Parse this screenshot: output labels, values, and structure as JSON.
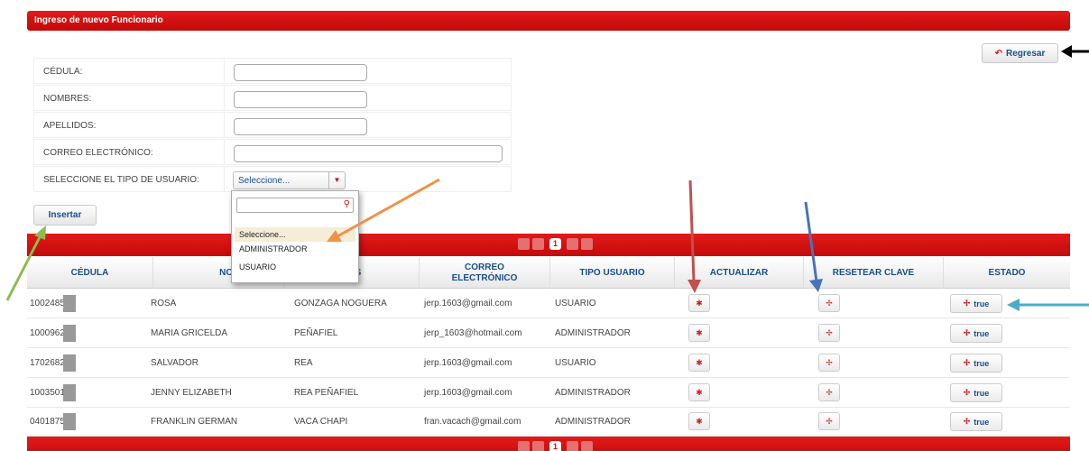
{
  "header": {
    "title": "Ingreso de nuevo Funcionario"
  },
  "back_button": {
    "label": "Regresar",
    "icon": "undo-icon"
  },
  "form": {
    "cedula_label": "CÉDULA:",
    "nombres_label": "NOMBRES:",
    "apellidos_label": "APELLIDOS:",
    "correo_label": "CORREO ELECTRÓNICO:",
    "tipo_label": "SELECCIONE EL TIPO DE USUARIO:",
    "tipo_selected": "Seleccione..."
  },
  "dropdown": {
    "options": [
      "Seleccione...",
      "ADMINISTRADOR",
      "USUARIO"
    ]
  },
  "insert_button": {
    "label": "Insertar"
  },
  "pager": {
    "current_page": "1"
  },
  "table": {
    "headers": [
      "CÉDULA",
      "NOMBRES",
      "APELLIDOS",
      "CORREO ELECTRÓNICO",
      "TIPO USUARIO",
      "ACTUALIZAR",
      "RESETEAR CLAVE",
      "ESTADO"
    ],
    "header_nombres_visible": "NOMBR",
    "header_apellidos_visible": "DOS",
    "rows": [
      {
        "cedula": "1002485",
        "nombres": "ROSA",
        "apellidos": "GONZAGA NOGUERA",
        "correo": "jerp.1603@gmail.com",
        "tipo": "USUARIO",
        "estado": "true"
      },
      {
        "cedula": "1000962",
        "nombres": "MARIA GRICELDA",
        "apellidos": "PEÑAFIEL",
        "correo": "jerp_1603@hotmail.com",
        "tipo": "ADMINISTRADOR",
        "estado": "true"
      },
      {
        "cedula": "1702682",
        "nombres": "SALVADOR",
        "apellidos": "REA",
        "correo": "jerp.1603@gmail.com",
        "tipo": "USUARIO",
        "estado": "true"
      },
      {
        "cedula": "1003501",
        "nombres": "JENNY ELIZABETH",
        "apellidos": "REA PEÑAFIEL",
        "correo": "jerp.1603@gmail.com",
        "tipo": "ADMINISTRADOR",
        "estado": "true"
      },
      {
        "cedula": "0401875",
        "nombres": "FRANKLIN GERMAN",
        "apellidos": "VACA CHAPI",
        "correo": "fran.vacach@gmail.com",
        "tipo": "ADMINISTRADOR",
        "estado": "true"
      }
    ]
  },
  "colors": {
    "brand_red": "#d10f0f",
    "link_blue": "#1a4d8f",
    "arrow_black": "#000000",
    "arrow_orange": "#f0924a",
    "arrow_green": "#8dbb4f",
    "arrow_red": "#c0504d",
    "arrow_blue": "#4a72b8",
    "arrow_cyan": "#4badc6"
  }
}
